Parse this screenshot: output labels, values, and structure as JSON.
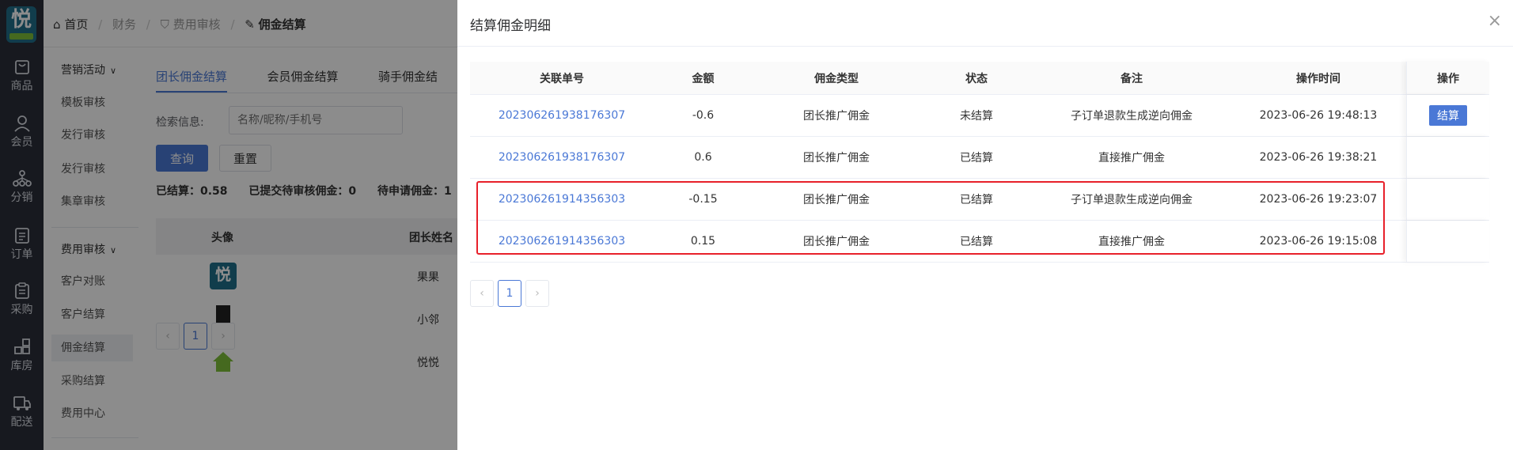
{
  "app": {
    "logo_char": "悦",
    "left_nav": [
      {
        "label": "商品",
        "icon": "bag-icon"
      },
      {
        "label": "会员",
        "icon": "user-icon"
      },
      {
        "label": "分销",
        "icon": "network-icon"
      },
      {
        "label": "订单",
        "icon": "document-icon"
      },
      {
        "label": "采购",
        "icon": "clipboard-icon"
      },
      {
        "label": "库房",
        "icon": "grid-icon"
      },
      {
        "label": "配送",
        "icon": "delivery-icon"
      }
    ]
  },
  "submenu": {
    "group1": "营销活动",
    "group1_items": [
      "模板审核",
      "发行审核",
      "发行审核",
      "集章审核"
    ],
    "group2": "费用审核",
    "group2_items": [
      "客户对账",
      "客户结算",
      "佣金结算",
      "采购结算",
      "费用中心"
    ]
  },
  "breadcrumb": {
    "home": "首页",
    "l1": "财务",
    "l2": "费用审核",
    "current": "佣金结算"
  },
  "main": {
    "tabs": [
      "团长佣金结算",
      "会员佣金结算",
      "骑手佣金结"
    ],
    "search_label": "检索信息:",
    "search_placeholder": "名称/昵称/手机号",
    "query_label": "查询",
    "reset_label": "重置",
    "stats": [
      "已结算：0.58",
      "已提交待审核佣金：0",
      "待申请佣金：1"
    ],
    "table_headers": [
      "头像",
      "团长姓名"
    ],
    "rows": [
      "果果",
      "小邻",
      "悦悦"
    ],
    "pager_current": "1"
  },
  "drawer": {
    "title": "结算佣金明细",
    "close": "×",
    "headers": [
      "关联单号",
      "金额",
      "佣金类型",
      "状态",
      "备注",
      "操作时间",
      "操作"
    ],
    "rows": [
      {
        "order": "202306261938176307",
        "amount": "-0.6",
        "type": "团长推广佣金",
        "status": "未结算",
        "note": "子订单退款生成逆向佣金",
        "time": "2023-06-26 19:48:13",
        "action": "结算"
      },
      {
        "order": "202306261938176307",
        "amount": "0.6",
        "type": "团长推广佣金",
        "status": "已结算",
        "note": "直接推广佣金",
        "time": "2023-06-26 19:38:21",
        "action": ""
      },
      {
        "order": "202306261914356303",
        "amount": "-0.15",
        "type": "团长推广佣金",
        "status": "已结算",
        "note": "子订单退款生成逆向佣金",
        "time": "2023-06-26 19:23:07",
        "action": ""
      },
      {
        "order": "202306261914356303",
        "amount": "0.15",
        "type": "团长推广佣金",
        "status": "已结算",
        "note": "直接推广佣金",
        "time": "2023-06-26 19:15:08",
        "action": ""
      }
    ],
    "pager_prev": "‹",
    "pager_current": "1",
    "pager_next": "›"
  },
  "colors": {
    "primary": "#4a78d6",
    "highlight": "#e8202a",
    "sidebar": "#2b2f3a"
  }
}
